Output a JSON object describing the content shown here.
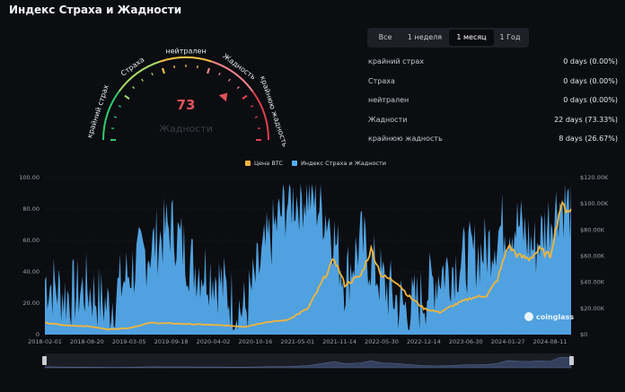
{
  "header": {
    "title": "Индекс Страха и Жадности"
  },
  "gauge": {
    "value": "73",
    "value_label": "Жадности",
    "segment_labels": [
      "крайний страх",
      "Страха",
      "нейтрален",
      "Жадность",
      "крайнюю жадность"
    ],
    "colors": {
      "extreme_fear": "#2ecc71",
      "fear": "#a8d86b",
      "neutral": "#f5c242",
      "greed": "#f0838a",
      "extreme_greed": "#e0404a"
    }
  },
  "tabs": [
    {
      "label": "Все"
    },
    {
      "label": "1 неделя"
    },
    {
      "label": "1 месяц",
      "active": true
    },
    {
      "label": "1 Год"
    }
  ],
  "stats": [
    {
      "label": "крайний страх",
      "value": "0 days (0.00%)"
    },
    {
      "label": "Страха",
      "value": "0 days (0.00%)"
    },
    {
      "label": "нейтрален",
      "value": "0 days (0.00%)"
    },
    {
      "label": "Жадности",
      "value": "22 days (73.33%)"
    },
    {
      "label": "крайнюю жадность",
      "value": "8 days (26.67%)"
    }
  ],
  "watermark": "coinglass",
  "chart_data": {
    "type": "area",
    "legend_position": "top-center",
    "series": [
      {
        "name": "Цена BTC",
        "color": "#f0b53a",
        "axis": "right"
      },
      {
        "name": "Индекс Страха и Жадности",
        "color": "#57aef1",
        "axis": "left"
      }
    ],
    "x_ticks": [
      "2018-02-01",
      "2018-08-20",
      "2019-03-05",
      "2019-09-18",
      "2020-04-02",
      "2020-10-16",
      "2021-05-01",
      "2021-11-14",
      "2022-05-30",
      "2022-12-14",
      "2023-06-30",
      "2024-01-27",
      "2024-08-11"
    ],
    "y_left_ticks": [
      "0",
      "20.00",
      "40.00",
      "60.00",
      "80.00",
      "100.00"
    ],
    "y_right_ticks": [
      "$0",
      "$20.00K",
      "$40.00K",
      "$60.00K",
      "$80.00K",
      "$100.00K",
      "$120.00K"
    ],
    "ylim_left": [
      0,
      100
    ],
    "ylim_right": [
      0,
      120000
    ],
    "grid": true,
    "fear_greed_keypoints": [
      [
        0,
        35
      ],
      [
        0.04,
        25
      ],
      [
        0.08,
        30
      ],
      [
        0.12,
        18
      ],
      [
        0.16,
        40
      ],
      [
        0.2,
        55
      ],
      [
        0.24,
        70
      ],
      [
        0.28,
        45
      ],
      [
        0.32,
        40
      ],
      [
        0.36,
        20
      ],
      [
        0.38,
        15
      ],
      [
        0.42,
        55
      ],
      [
        0.46,
        85
      ],
      [
        0.5,
        90
      ],
      [
        0.54,
        75
      ],
      [
        0.57,
        35
      ],
      [
        0.6,
        60
      ],
      [
        0.63,
        40
      ],
      [
        0.66,
        25
      ],
      [
        0.69,
        15
      ],
      [
        0.72,
        25
      ],
      [
        0.75,
        40
      ],
      [
        0.78,
        45
      ],
      [
        0.81,
        50
      ],
      [
        0.84,
        55
      ],
      [
        0.87,
        70
      ],
      [
        0.9,
        70
      ],
      [
        0.93,
        55
      ],
      [
        0.96,
        75
      ],
      [
        0.98,
        85
      ],
      [
        1,
        80
      ]
    ],
    "btc_price_keypoints": [
      [
        0,
        9000
      ],
      [
        0.04,
        7000
      ],
      [
        0.08,
        6500
      ],
      [
        0.12,
        4000
      ],
      [
        0.16,
        5000
      ],
      [
        0.2,
        9000
      ],
      [
        0.24,
        8500
      ],
      [
        0.28,
        8000
      ],
      [
        0.34,
        7000
      ],
      [
        0.38,
        6000
      ],
      [
        0.42,
        9500
      ],
      [
        0.46,
        11000
      ],
      [
        0.5,
        20000
      ],
      [
        0.52,
        35000
      ],
      [
        0.55,
        58000
      ],
      [
        0.57,
        38000
      ],
      [
        0.6,
        45000
      ],
      [
        0.62,
        65000
      ],
      [
        0.64,
        45000
      ],
      [
        0.67,
        40000
      ],
      [
        0.69,
        30000
      ],
      [
        0.72,
        20000
      ],
      [
        0.75,
        17000
      ],
      [
        0.78,
        23000
      ],
      [
        0.81,
        28000
      ],
      [
        0.84,
        30000
      ],
      [
        0.86,
        42000
      ],
      [
        0.88,
        68000
      ],
      [
        0.9,
        60000
      ],
      [
        0.92,
        58000
      ],
      [
        0.94,
        65000
      ],
      [
        0.96,
        60000
      ],
      [
        0.98,
        98000
      ],
      [
        1,
        95000
      ]
    ]
  }
}
